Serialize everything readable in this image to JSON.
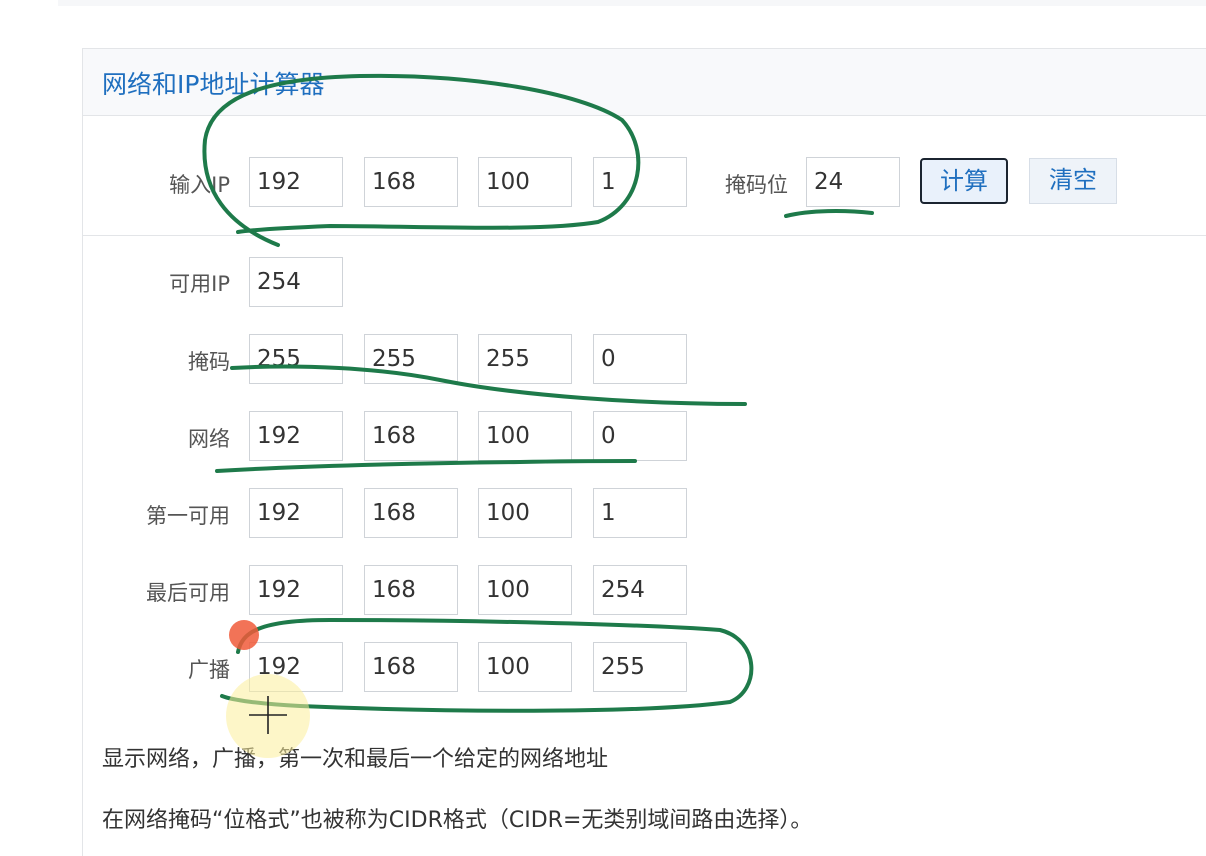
{
  "title": "网络和IP地址计算器",
  "input": {
    "label": "输入IP",
    "octets": [
      "192",
      "168",
      "100",
      "1"
    ],
    "mask_bits_label": "掩码位",
    "mask_bits": "24",
    "calc_label": "计算",
    "clear_label": "清空"
  },
  "results": {
    "usable": {
      "label": "可用IP",
      "value": "254"
    },
    "mask": {
      "label": "掩码",
      "octets": [
        "255",
        "255",
        "255",
        "0"
      ]
    },
    "network": {
      "label": "网络",
      "octets": [
        "192",
        "168",
        "100",
        "0"
      ]
    },
    "first": {
      "label": "第一可用",
      "octets": [
        "192",
        "168",
        "100",
        "1"
      ]
    },
    "last": {
      "label": "最后可用",
      "octets": [
        "192",
        "168",
        "100",
        "254"
      ]
    },
    "broadcast": {
      "label": "广播",
      "octets": [
        "192",
        "168",
        "100",
        "255"
      ]
    }
  },
  "description": {
    "line1": "显示网络，广播，第一次和最后一个给定的网络地址",
    "line2": "在网络掩码“位格式”也被称为CIDR格式（CIDR=无类别域间路由选择）。"
  },
  "colors": {
    "title": "#1f6fbf",
    "annotation": "#1e7a4a",
    "cursor_dot": "#f05a3a"
  }
}
